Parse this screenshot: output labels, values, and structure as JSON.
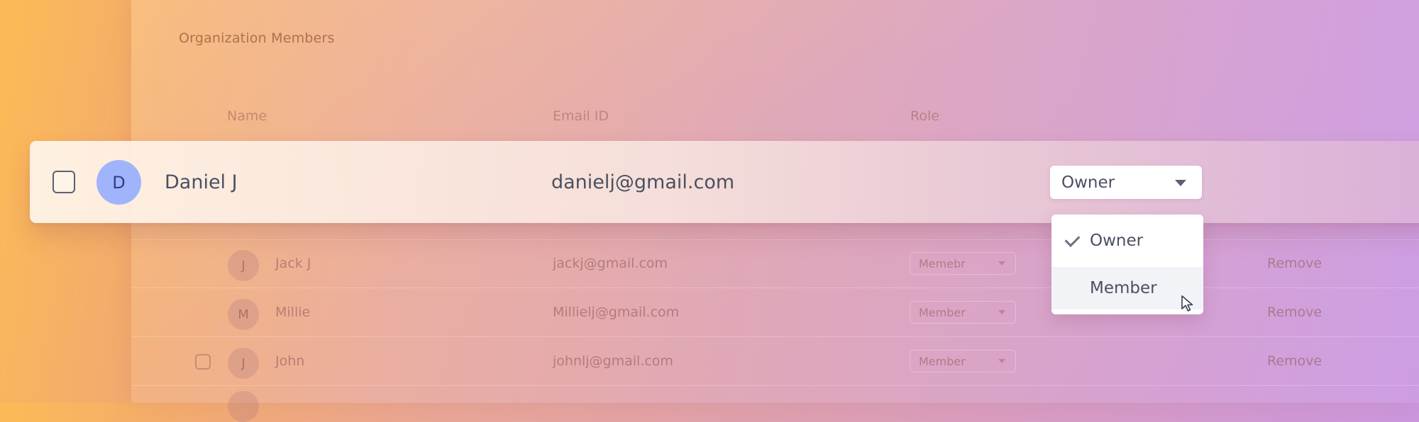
{
  "page": {
    "title": "Organization Members"
  },
  "table": {
    "headers": {
      "name": "Name",
      "email": "Email ID",
      "role": "Role"
    },
    "focused_row": {
      "avatar_letter": "D",
      "name": "Daniel J",
      "email": "danielj@gmail.com",
      "role": "Owner"
    },
    "rows": [
      {
        "avatar_letter": "J",
        "name": "Jack J",
        "email": "jackj@gmail.com",
        "role": "Memebr",
        "action": "Remove"
      },
      {
        "avatar_letter": "M",
        "name": "Millie",
        "email": "Millielj@gmail.com",
        "role": "Member",
        "action": "Remove"
      },
      {
        "avatar_letter": "J",
        "name": "John",
        "email": "johnlj@gmail.com",
        "role": "Member",
        "action": "Remove"
      }
    ]
  },
  "role_dropdown": {
    "options": [
      {
        "label": "Owner",
        "selected": true
      },
      {
        "label": "Member",
        "selected": false,
        "hovered": true
      }
    ]
  },
  "colors": {
    "avatar_focus_bg": "#9fb4fb",
    "avatar_focus_text": "#2f3e86",
    "text_primary": "#4b5062"
  }
}
